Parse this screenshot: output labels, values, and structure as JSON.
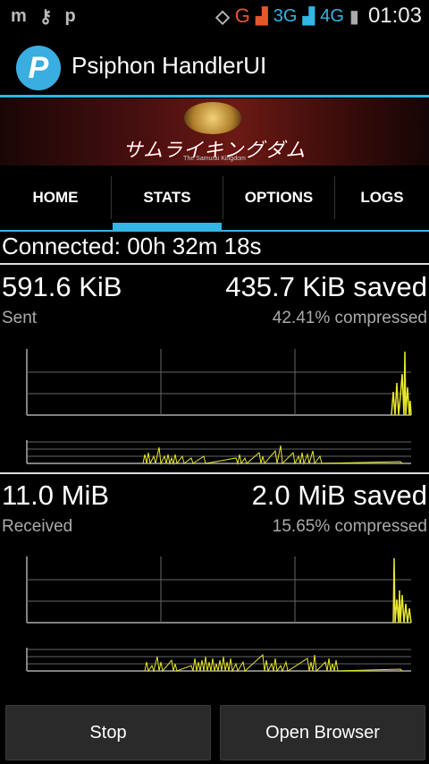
{
  "status_bar": {
    "left_icons": [
      "m",
      "key-icon",
      "p"
    ],
    "carrier_letter": "G",
    "network_3g": "3G",
    "network_4g": "4G",
    "time": "01:03"
  },
  "app": {
    "title": "Psiphon HandlerUI",
    "logo_letter": "P"
  },
  "banner": {
    "title": "サムライキングダム",
    "subtitle": "The Samurai Kingdom"
  },
  "tabs": [
    {
      "label": "HOME"
    },
    {
      "label": "STATS"
    },
    {
      "label": "OPTIONS"
    },
    {
      "label": "LOGS"
    }
  ],
  "active_tab": "STATS",
  "stats": {
    "connected": "Connected: 00h 32m 18s",
    "sent": {
      "amount": "591.6 KiB",
      "label": "Sent",
      "saved": "435.7 KiB saved",
      "compressed": "42.41% compressed"
    },
    "received": {
      "amount": "11.0 MiB",
      "label": "Received",
      "saved": "2.0 MiB saved",
      "compressed": "15.65% compressed"
    }
  },
  "buttons": {
    "stop": "Stop",
    "open_browser": "Open Browser"
  },
  "colors": {
    "accent": "#33b5e5",
    "graph_line": "#e8e82a"
  }
}
